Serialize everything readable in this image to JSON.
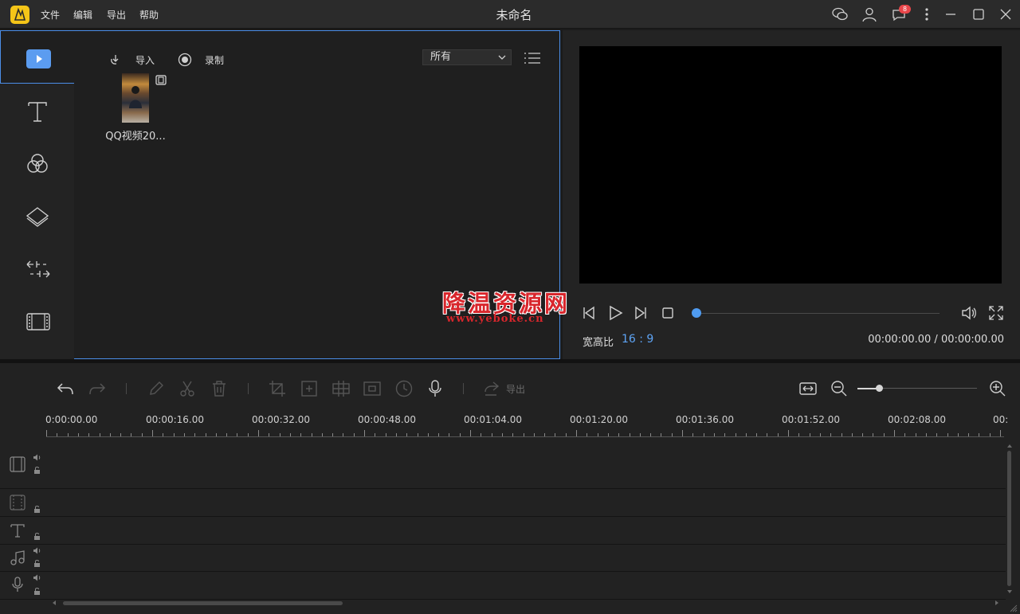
{
  "app": {
    "title": "未命名",
    "menu": [
      "文件",
      "编辑",
      "导出",
      "帮助"
    ],
    "notification_count": "8"
  },
  "rail": {
    "items": [
      "media",
      "text",
      "filters",
      "overlays",
      "transitions",
      "elements"
    ]
  },
  "library": {
    "import_label": "导入",
    "record_label": "录制",
    "filter_value": "所有",
    "items": [
      {
        "name": "QQ视频20..."
      }
    ]
  },
  "preview": {
    "aspect_label": "宽高比",
    "aspect_value": "16 : 9",
    "time_current": "00:00:00.00",
    "time_total": "00:00:00.00",
    "time_display": "00:00:00.00 / 00:00:00.00",
    "progress": 0
  },
  "watermark": {
    "text": "降温资源网",
    "url": "www.yeboke.cn"
  },
  "timeline": {
    "export_label": "导出",
    "ruler": [
      "0:00:00.00",
      "00:00:16.00",
      "00:00:32.00",
      "00:00:48.00",
      "00:01:04.00",
      "00:01:20.00",
      "00:01:36.00",
      "00:01:52.00",
      "00:02:08.00",
      "00:"
    ],
    "tracks": [
      "video-main",
      "pip",
      "text",
      "music",
      "voice"
    ]
  },
  "colors": {
    "accent": "#4b8ee8",
    "badge": "#e8464a",
    "logo": "#f5c518",
    "watermark": "#d8262c"
  }
}
